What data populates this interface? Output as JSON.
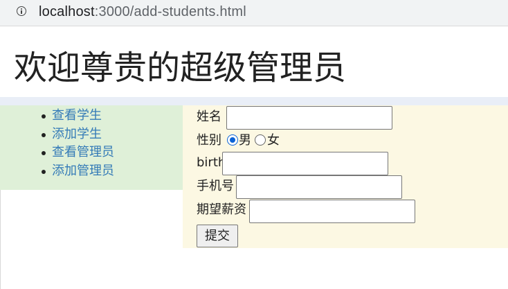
{
  "browser": {
    "url_host": "localhost",
    "url_path": ":3000/add-students.html"
  },
  "page": {
    "title": "欢迎尊贵的超级管理员"
  },
  "sidebar": {
    "items": [
      {
        "label": "查看学生"
      },
      {
        "label": "添加学生"
      },
      {
        "label": "查看管理员"
      },
      {
        "label": "添加管理员"
      }
    ]
  },
  "form": {
    "name_label": "姓名",
    "name_value": "",
    "gender_label": "性别",
    "gender_options": [
      {
        "label": "男",
        "checked": true
      },
      {
        "label": "女",
        "checked": false
      }
    ],
    "birth_label": "birth",
    "birth_value": "",
    "phone_label": "手机号",
    "phone_value": "",
    "salary_label": "期望薪资",
    "salary_value": "",
    "submit_label": "提交"
  },
  "colors": {
    "sidebar_background": "#dff0d8",
    "form_background": "#fcf8e3",
    "link": "#337ab7",
    "radio_accent": "#0b63d6"
  }
}
